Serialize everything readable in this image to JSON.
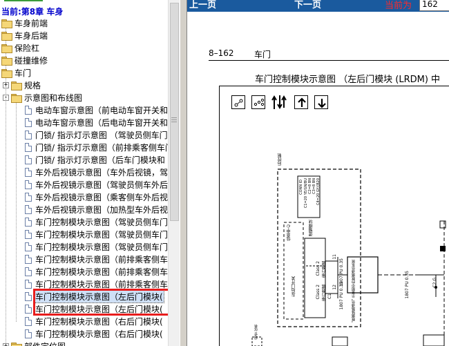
{
  "tree": {
    "chapter_label": "当前:第8章  车身",
    "folders": [
      {
        "label": "车身前端"
      },
      {
        "label": "车身后端"
      },
      {
        "label": "保险杠"
      },
      {
        "label": "碰撞维修"
      },
      {
        "label": "车门"
      }
    ],
    "door_children": [
      {
        "label": "规格",
        "expander": "+"
      },
      {
        "label": "示意图和布线图",
        "expander": "-"
      }
    ],
    "docs": [
      {
        "label": "电动车窗示意图（前电动车窗开关和"
      },
      {
        "label": "电动车窗示意图（后电动车窗开关和"
      },
      {
        "label": "门锁/ 指示灯示意图 （驾驶员侧车门"
      },
      {
        "label": "门锁/ 指示灯示意图（前排乘客侧车门"
      },
      {
        "label": "门锁/ 指示灯示意图（后车门模块和"
      },
      {
        "label": "车外后视镜示意图（车外后视镜，驾"
      },
      {
        "label": "车外后视镜示意图（驾驶员侧车外后"
      },
      {
        "label": "车外后视镜示意图（乘客侧车外后视"
      },
      {
        "label": "车外后视镜示意图（加热型车外后视"
      },
      {
        "label": "车门控制模块示意图（驾驶员侧车门"
      },
      {
        "label": "车门控制模块示意图（驾驶员侧车门"
      },
      {
        "label": "车门控制模块示意图（驾驶员侧车门"
      },
      {
        "label": "车门控制模块示意图（前排乘客侧车"
      },
      {
        "label": "车门控制模块示意图（前排乘客侧车"
      },
      {
        "label": "车门控制模块示意图（前排乘客侧车"
      },
      {
        "label": "车门控制模块示意图（左后门模块("
      },
      {
        "label": "车门控制模块示意图（左后门模块("
      },
      {
        "label": "车门控制模块示意图（右后门模块("
      },
      {
        "label": "车门控制模块示意图（右后门模块("
      }
    ],
    "last_folder": {
      "label": "部件定位图"
    },
    "selected_index": 15
  },
  "nav": {
    "prev_label": "上一页",
    "next_label": "下一页",
    "current_label": "当前为",
    "current_page": "162"
  },
  "page": {
    "number": "8–162",
    "section": "车门",
    "diagram_title": "车门控制模块示意图 （左后门模块 (LRDM) 中"
  },
  "diagram": {
    "left_vertical_label": "后控制",
    "connector_block": [
      "CONN ID",
      "C1=20 YE/GN/BU",
      "C2=8 BN",
      "C3=8 BN",
      "C4=20 GY/(B20"
    ],
    "center_label": "信息中心",
    "box_right_label": "逻辑模块",
    "left_module_label": "左后门开关",
    "class2_a": "Class 2",
    "class2_b": "Class 2",
    "class2_sub_a": "串行数据",
    "class2_sub_b": "串行数据",
    "wire_a": "1807 PU 0.35",
    "wire_b": "1807 PU 0.35",
    "wire_c": "1807 PU 0.35",
    "pin_a": "11",
    "pin_b": "12",
    "conn_c1": "C1",
    "conn_c2": "C2 G",
    "center_box": "\"数据链路通信\" 示意图中的数据通信系统",
    "connector_side": "C1",
    "bottom_label": "组合 仪表"
  },
  "colors": {
    "navbar": "#1a5a9e",
    "current_label": "#ff2a2a",
    "highlight_box": "#e81c1c",
    "chapter_text": "#0000cc"
  }
}
